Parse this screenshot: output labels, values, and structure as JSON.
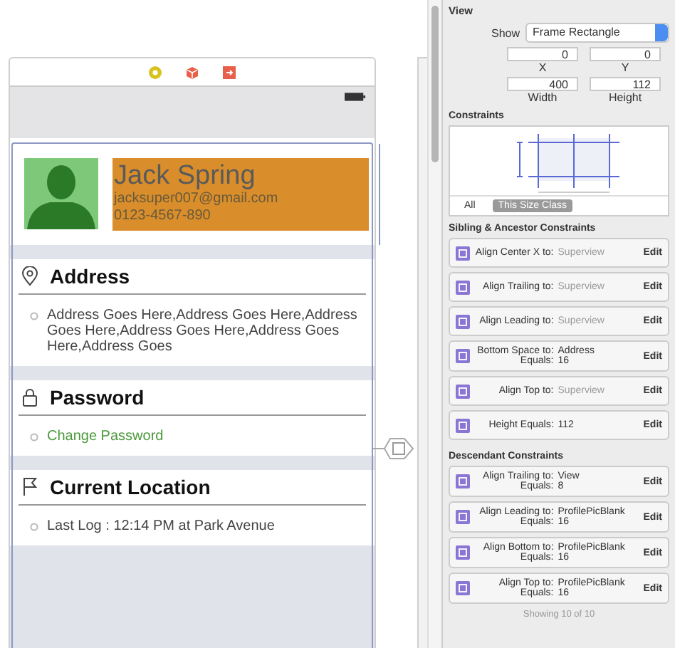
{
  "profile": {
    "name": "Jack Spring",
    "email": "jacksuper007@gmail.com",
    "phone": "0123-4567-890"
  },
  "sections": [
    {
      "kind": "address",
      "title": "Address",
      "text": "Address Goes Here,Address Goes Here,Address Goes Here,Address Goes Here,Address Goes Here,Address Goes",
      "link": false
    },
    {
      "kind": "password",
      "title": "Password",
      "text": "Change Password",
      "link": true
    },
    {
      "kind": "location",
      "title": "Current Location",
      "text": "Last Log : 12:14 PM at Park Avenue",
      "link": false
    }
  ],
  "inspector": {
    "title": "View",
    "show_label": "Show",
    "show_value": "Frame Rectangle",
    "fields": [
      {
        "value": "0",
        "label": "X"
      },
      {
        "value": "0",
        "label": "Y"
      },
      {
        "value": "400",
        "label": "Width"
      },
      {
        "value": "112",
        "label": "Height"
      }
    ],
    "constraints_title": "Constraints",
    "size_tabs": [
      {
        "label": "All",
        "selected": false
      },
      {
        "label": "This Size Class",
        "selected": true
      }
    ],
    "groups": [
      {
        "title": "Sibling & Ancestor Constraints",
        "rows": [
          {
            "label": "Align Center X to:",
            "target": "Superview",
            "dimmed": true,
            "edit": "Edit"
          },
          {
            "label": "Align Trailing to:",
            "target": "Superview",
            "dimmed": true,
            "edit": "Edit"
          },
          {
            "label": "Align Leading to:",
            "target": "Superview",
            "dimmed": true,
            "edit": "Edit"
          },
          {
            "label": "Bottom Space to:",
            "target": "Address",
            "dimmed": false,
            "equals_label": "Equals:",
            "equals": "16",
            "edit": "Edit"
          },
          {
            "label": "Align Top to:",
            "target": "Superview",
            "dimmed": true,
            "edit": "Edit"
          },
          {
            "label": "Height Equals:",
            "target": "112",
            "dimmed": false,
            "edit": "Edit"
          }
        ]
      },
      {
        "title": "Descendant Constraints",
        "rows": [
          {
            "label": "Align Trailing to:",
            "target": "View",
            "dimmed": false,
            "equals_label": "Equals:",
            "equals": "8",
            "edit": "Edit"
          },
          {
            "label": "Align Leading to:",
            "target": "ProfilePicBlank",
            "dimmed": false,
            "equals_label": "Equals:",
            "equals": "16",
            "edit": "Edit"
          },
          {
            "label": "Align Bottom to:",
            "target": "ProfilePicBlank",
            "dimmed": false,
            "equals_label": "Equals:",
            "equals": "16",
            "edit": "Edit"
          },
          {
            "label": "Align Top to:",
            "target": "ProfilePicBlank",
            "dimmed": false,
            "equals_label": "Equals:",
            "equals": "16",
            "edit": "Edit"
          }
        ]
      }
    ],
    "footer": "Showing 10 of 10"
  }
}
